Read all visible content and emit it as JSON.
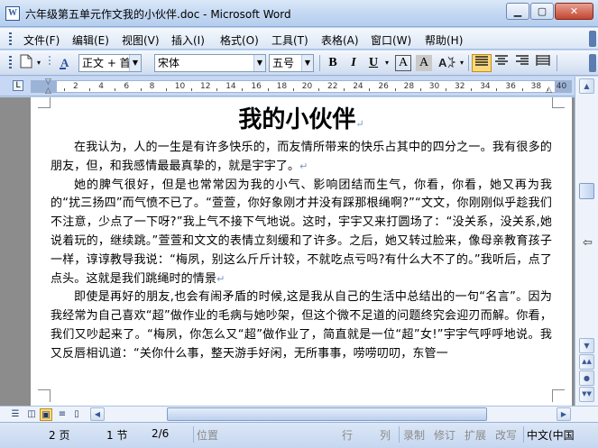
{
  "window": {
    "title": "六年级第五单元作文我的小伙伴.doc - Microsoft Word",
    "app_icon_letter": "W",
    "min_glyph": "▁",
    "max_glyph": "▢",
    "close_glyph": "✕"
  },
  "menu": {
    "items": [
      "文件(F)",
      "编辑(E)",
      "视图(V)",
      "插入(I)",
      "格式(O)",
      "工具(T)",
      "表格(A)",
      "窗口(W)",
      "帮助(H)"
    ]
  },
  "toolbar": {
    "style_value": "正文 + 首行",
    "font_value": "宋体",
    "size_value": "五号",
    "bold_label": "B",
    "italic_label": "I",
    "underline_label": "U",
    "font_color_label": "A",
    "char_border_label": "A"
  },
  "ruler": {
    "numbers": [
      "2",
      "4",
      "6",
      "8",
      "10",
      "12",
      "14",
      "16",
      "18",
      "20",
      "22",
      "24",
      "26",
      "28",
      "30",
      "32",
      "34",
      "36",
      "38",
      "40"
    ],
    "corner_glyph": "L"
  },
  "document": {
    "title": "我的小伙伴",
    "paragraph_mark": "↵",
    "paragraphs": [
      "在我认为，人的一生是有许多快乐的，而友情所带来的快乐占其中的四分之一。我有很多的朋友，但，和我感情最最真挚的，就是宇宇了。",
      "她的脾气很好，但是也常常因为我的小气、影响团结而生气，你看，你看，她又再为我的“扰三扬四”而气愤不已了。“萱萱，你好象刚才并没有踩那根绳啊?”“文文，你刚刚似乎趁我们不注意，少点了一下呀?”我上气不接下气地说。这时，宇宇又来打圆场了：“没关系，没关系,她说着玩的，继续跳。”萱萱和文文的表情立刻缓和了许多。之后，她又转过脸来，像母亲教育孩子一样，谆谆教导我说：“梅夙，别这么斤斤计较，不就吃点亏吗?有什么大不了的。”我听后，点了点头。这就是我们跳绳时的情景",
      "即使是再好的朋友,也会有闹矛盾的时候,这是我从自己的生活中总结出的一句“名言”。因为我经常为自己喜欢“超”做作业的毛病与她吵架，但这个微不足道的问题终究会迎刃而解。你看，我们又吵起来了。“梅夙，你怎么又“超”做作业了，简直就是一位“超”女!”宇宇气呼呼地说。我又反唇相讥道：“关你什么事，整天游手好闲，无所事事，唠唠叨叨，东管一"
    ]
  },
  "statusbar": {
    "page": "2 页",
    "section": "1 节",
    "page_of": "2/6",
    "position": "位置",
    "line": "行",
    "column": "列",
    "rec": "录制",
    "trk": "修订",
    "ext": "扩展",
    "ovr": "改写",
    "language": "中文(中国"
  }
}
